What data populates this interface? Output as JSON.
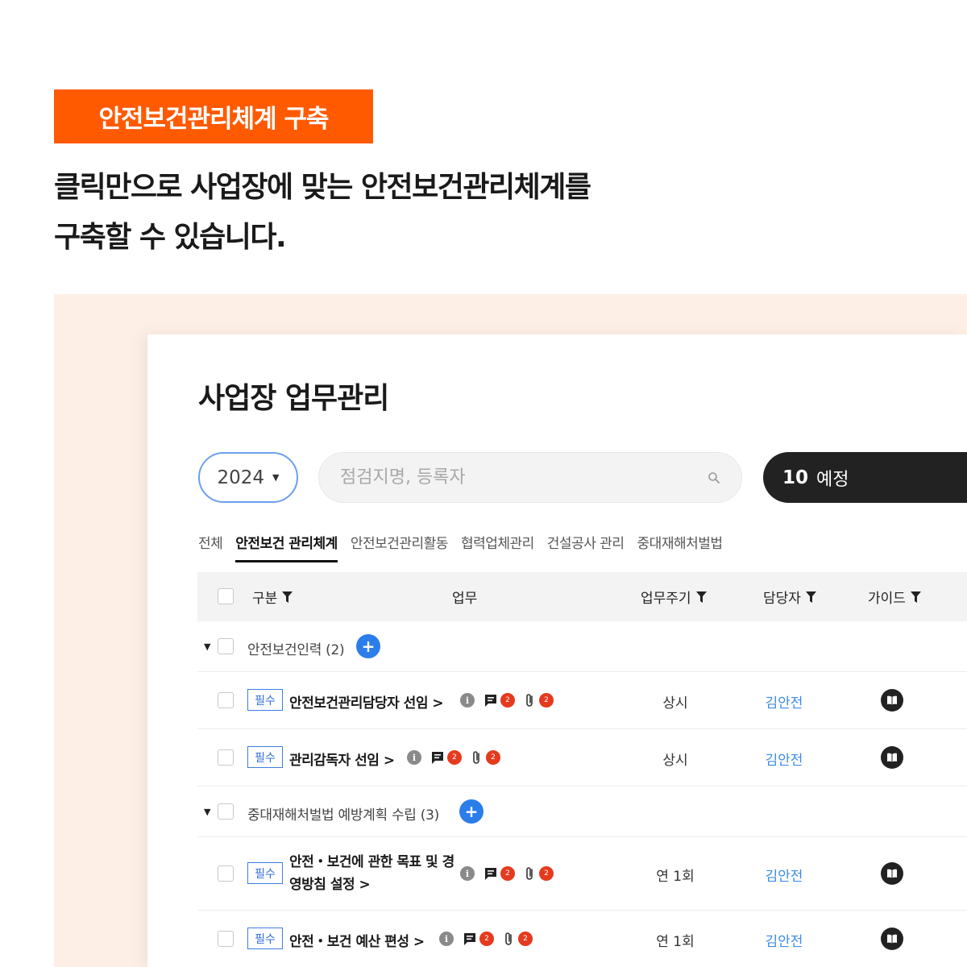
{
  "banner": {
    "badge": "안전보건관리체계 구축",
    "headline_line1": "클릭만으로 사업장에 맞는 안전보건관리체계를",
    "headline_line2": "구축할 수 있습니다.",
    "accent_color": "#ff5a00"
  },
  "app": {
    "title": "사업장 업무관리",
    "year_select": {
      "value": "2024"
    },
    "search": {
      "placeholder": "점검지명, 등록자"
    },
    "scheduled": {
      "count": "10",
      "label": "예정"
    },
    "tabs": [
      {
        "label": "전체",
        "active": false
      },
      {
        "label": "안전보건 관리체계",
        "active": true
      },
      {
        "label": "안전보건관리활동",
        "active": false
      },
      {
        "label": "협력업체관리",
        "active": false
      },
      {
        "label": "건설공사 관리",
        "active": false
      },
      {
        "label": "중대재해처벌법",
        "active": false
      }
    ],
    "table": {
      "headers": {
        "category": "구분",
        "task": "업무",
        "cycle": "업무주기",
        "assignee": "담당자",
        "guide": "가이드"
      },
      "groups": [
        {
          "label": "안전보건인력 (2)",
          "rows": [
            {
              "badge": "필수",
              "name": "안전보건관리담당자 선임 >",
              "comments": "2",
              "attachments": "2",
              "cycle": "상시",
              "assignee": "김안전"
            },
            {
              "badge": "필수",
              "name": "관리감독자 선임 >",
              "comments": "2",
              "attachments": "2",
              "cycle": "상시",
              "assignee": "김안전"
            }
          ]
        },
        {
          "label": "중대재해처벌법 예방계획 수립 (3)",
          "rows": [
            {
              "badge": "필수",
              "name": "안전・보건에 관한 목표 및 경영방침 설정 >",
              "comments": "2",
              "attachments": "2",
              "cycle": "연 1회",
              "assignee": "김안전"
            },
            {
              "badge": "필수",
              "name": "안전・보건 예산 편성 >",
              "comments": "2",
              "attachments": "2",
              "cycle": "연 1회",
              "assignee": "김안전"
            }
          ]
        }
      ]
    },
    "colors": {
      "primary_blue": "#2b7de9",
      "badge_red": "#e53a1e",
      "dark": "#222222",
      "peach_bg": "#fdeee6"
    }
  }
}
